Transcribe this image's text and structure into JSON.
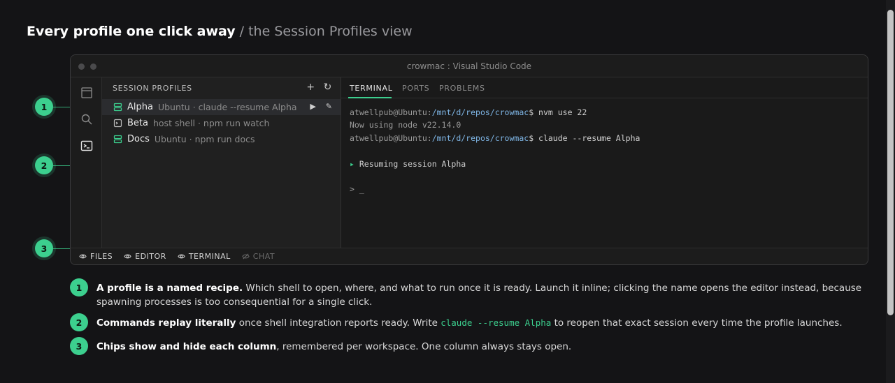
{
  "headline": {
    "strong": "Every profile one click away",
    "light": " / the Session Profiles view"
  },
  "window": {
    "title": "crowmac : Visual Studio Code"
  },
  "activity_bar": {
    "icons": [
      "explorer-icon",
      "search-icon",
      "terminal-icon"
    ]
  },
  "sidebar": {
    "header": "SESSION PROFILES",
    "actions": {
      "add": "+",
      "refresh": "↻"
    },
    "profiles": [
      {
        "name": "Alpha",
        "desc": "Ubuntu · claude --resume Alpha",
        "icon": "server-icon",
        "selected": true
      },
      {
        "name": "Beta",
        "desc": "host shell · npm run watch",
        "icon": "terminal-box-icon",
        "selected": false
      },
      {
        "name": "Docs",
        "desc": "Ubuntu · npm run docs",
        "icon": "server-icon",
        "selected": false
      }
    ]
  },
  "panel": {
    "tabs": [
      "TERMINAL",
      "PORTS",
      "PROBLEMS"
    ],
    "active_tab": "TERMINAL",
    "terminal": {
      "line1_user": "atwellpub@Ubuntu:",
      "line1_path": "/mnt/d/repos/crowmac",
      "line1_cmd": "$ nvm use 22",
      "line2": "Now using node v22.14.0",
      "line3_user": "atwellpub@Ubuntu:",
      "line3_path": "/mnt/d/repos/crowmac",
      "line3_cmd": "$ claude --resume Alpha",
      "line4_marker": "▸",
      "line4": " Resuming session Alpha",
      "prompt": "> _"
    }
  },
  "chips": [
    {
      "label": "FILES",
      "on": true
    },
    {
      "label": "EDITOR",
      "on": true
    },
    {
      "label": "TERMINAL",
      "on": true
    },
    {
      "label": "CHAT",
      "on": false
    }
  ],
  "markers": [
    "1",
    "2",
    "3"
  ],
  "notes": [
    {
      "num": "1",
      "bold": "A profile is a named recipe.",
      "text": " Which shell to open, where, and what to run once it is ready. Launch it inline; clicking the name opens the editor instead, because spawning processes is too consequential for a single click."
    },
    {
      "num": "2",
      "bold": "Commands replay literally",
      "text_before": " once shell integration reports ready. Write ",
      "code": "claude --resume Alpha",
      "text_after": " to reopen that exact session every time the profile launches."
    },
    {
      "num": "3",
      "bold": "Chips show and hide each column",
      "text": ", remembered per workspace. One column always stays open."
    }
  ],
  "colors": {
    "accent": "#3ccf8e",
    "path": "#7fb6e6"
  }
}
